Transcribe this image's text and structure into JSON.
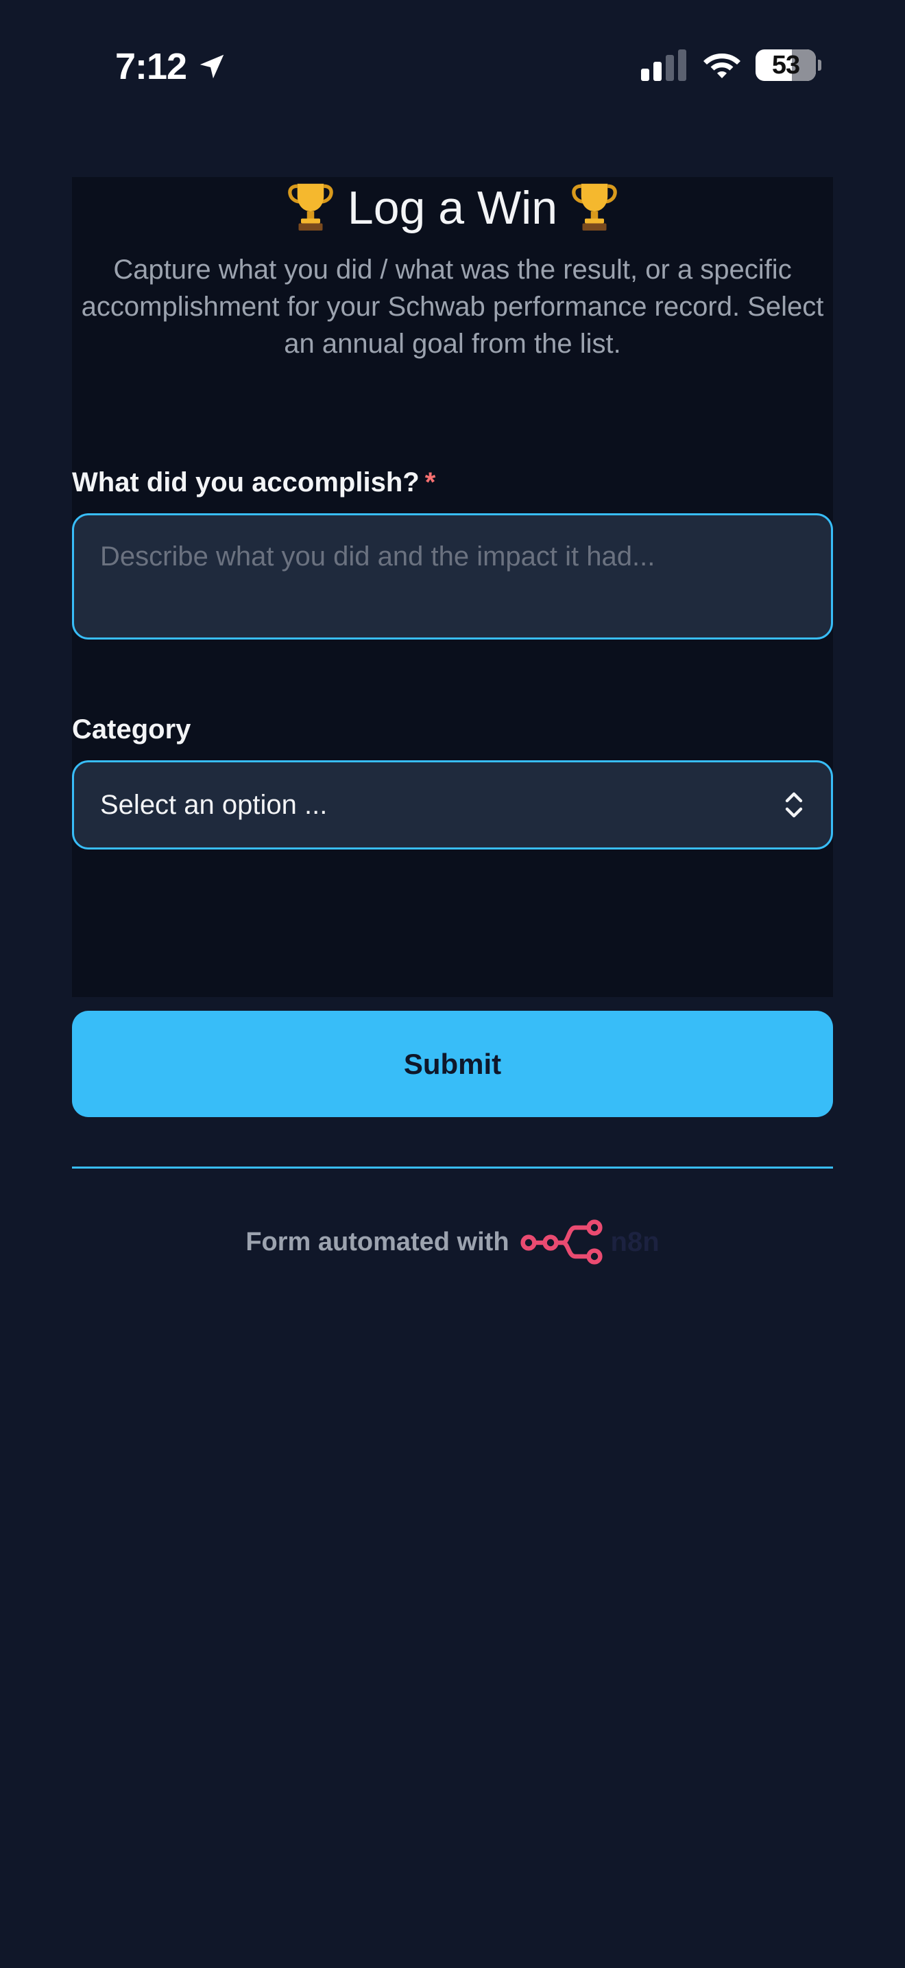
{
  "status_bar": {
    "time": "7:12",
    "battery_level": "53",
    "icons": [
      "location-arrow-icon",
      "cellular-signal-icon",
      "wifi-icon",
      "battery-icon"
    ]
  },
  "form": {
    "title": "Log a Win",
    "title_icon": "trophy-icon",
    "description": "Capture what you did / what was the result, or a specific accomplishment for your Schwab performance record. Select an annual goal from the list.",
    "fields": [
      {
        "label": "What did you accomplish?",
        "required_marker": "*",
        "placeholder": "Describe what you did and the impact it had..."
      },
      {
        "label": "Category",
        "selected_value": "Select an option ..."
      }
    ],
    "submit_label": "Submit"
  },
  "footer": {
    "text": "Form automated with",
    "brand": "n8n",
    "brand_icon": "n8n-logo-icon"
  },
  "colors": {
    "page_background": "#101729",
    "card_background": "#0a0f1c",
    "accent": "#38bdf8",
    "input_background": "#1f2a3d",
    "required": "#f87171",
    "brand_logo": "#ea4b71"
  }
}
